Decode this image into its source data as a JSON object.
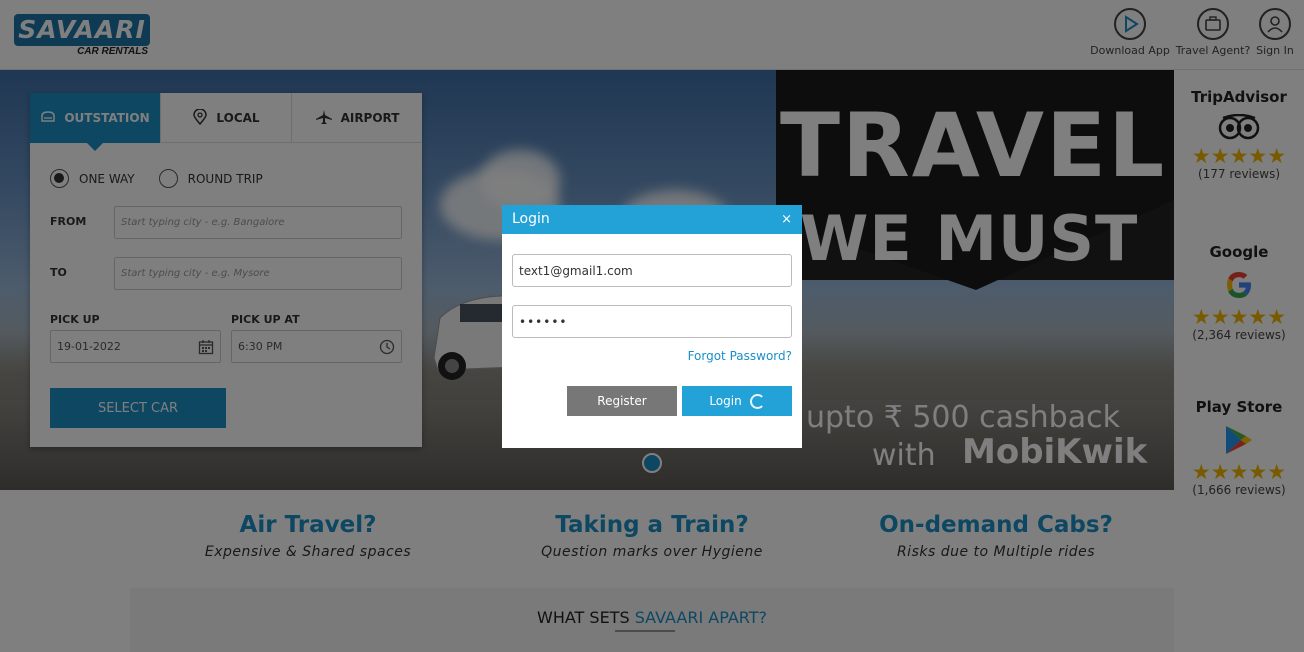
{
  "brand": {
    "name": "SAVAARI",
    "tagline": "CAR RENTALS",
    "color": "#1c75a8"
  },
  "header": {
    "actions": [
      {
        "label": "Download App",
        "icon": "play-store-icon"
      },
      {
        "label": "Travel Agent?",
        "icon": "briefcase-icon"
      },
      {
        "label": "Sign In",
        "icon": "user-icon"
      }
    ]
  },
  "booking": {
    "tabs": [
      {
        "label": "OUTSTATION",
        "icon": "car-front-icon",
        "active": true
      },
      {
        "label": "LOCAL",
        "icon": "location-pin-icon",
        "active": false
      },
      {
        "label": "AIRPORT",
        "icon": "airplane-icon",
        "active": false
      }
    ],
    "trip_types": [
      {
        "label": "ONE WAY",
        "selected": true
      },
      {
        "label": "ROUND TRIP",
        "selected": false
      }
    ],
    "from": {
      "label": "FROM",
      "placeholder": "Start typing city - e.g. Bangalore"
    },
    "to": {
      "label": "TO",
      "placeholder": "Start typing city - e.g. Mysore"
    },
    "pickup": {
      "label": "PICK UP",
      "value": "19-01-2022",
      "icon": "calendar-icon"
    },
    "pickup_at": {
      "label": "PICK UP AT",
      "value": "6:30 PM",
      "icon": "clock-icon"
    },
    "submit_label": "SELECT CAR"
  },
  "banner": {
    "line1": "TRAVEL",
    "line2": "WE MUST",
    "cashback": "upto ₹ 500 cashback",
    "with": "with",
    "partner": "MobiKwik"
  },
  "reviews": [
    {
      "source": "TripAdvisor",
      "count": "(177 reviews)",
      "rating": 5,
      "icon": "tripadvisor-owl-icon"
    },
    {
      "source": "Google",
      "count": "(2,364 reviews)",
      "rating": 4.5,
      "icon": "google-g-icon"
    },
    {
      "source": "Play Store",
      "count": "(1,666 reviews)",
      "rating": 4.5,
      "icon": "play-store-icon"
    }
  ],
  "features": [
    {
      "title": "Air Travel?",
      "subtitle": "Expensive & Shared spaces"
    },
    {
      "title": "Taking a Train?",
      "subtitle": "Question marks over Hygiene"
    },
    {
      "title": "On-demand Cabs?",
      "subtitle": "Risks due to Multiple rides"
    }
  ],
  "apart": {
    "prefix": "WHAT SETS ",
    "highlight": "SAVAARI APART?"
  },
  "login_modal": {
    "title": "Login",
    "close": "×",
    "email_value": "text1@gmail1.com",
    "password_value": "••••••",
    "forgot_label": "Forgot Password?",
    "register_label": "Register",
    "login_label": "Login"
  },
  "colors": {
    "accent": "#1a8fc5",
    "modal_header": "#23a2d8",
    "star": "#f0b400"
  }
}
